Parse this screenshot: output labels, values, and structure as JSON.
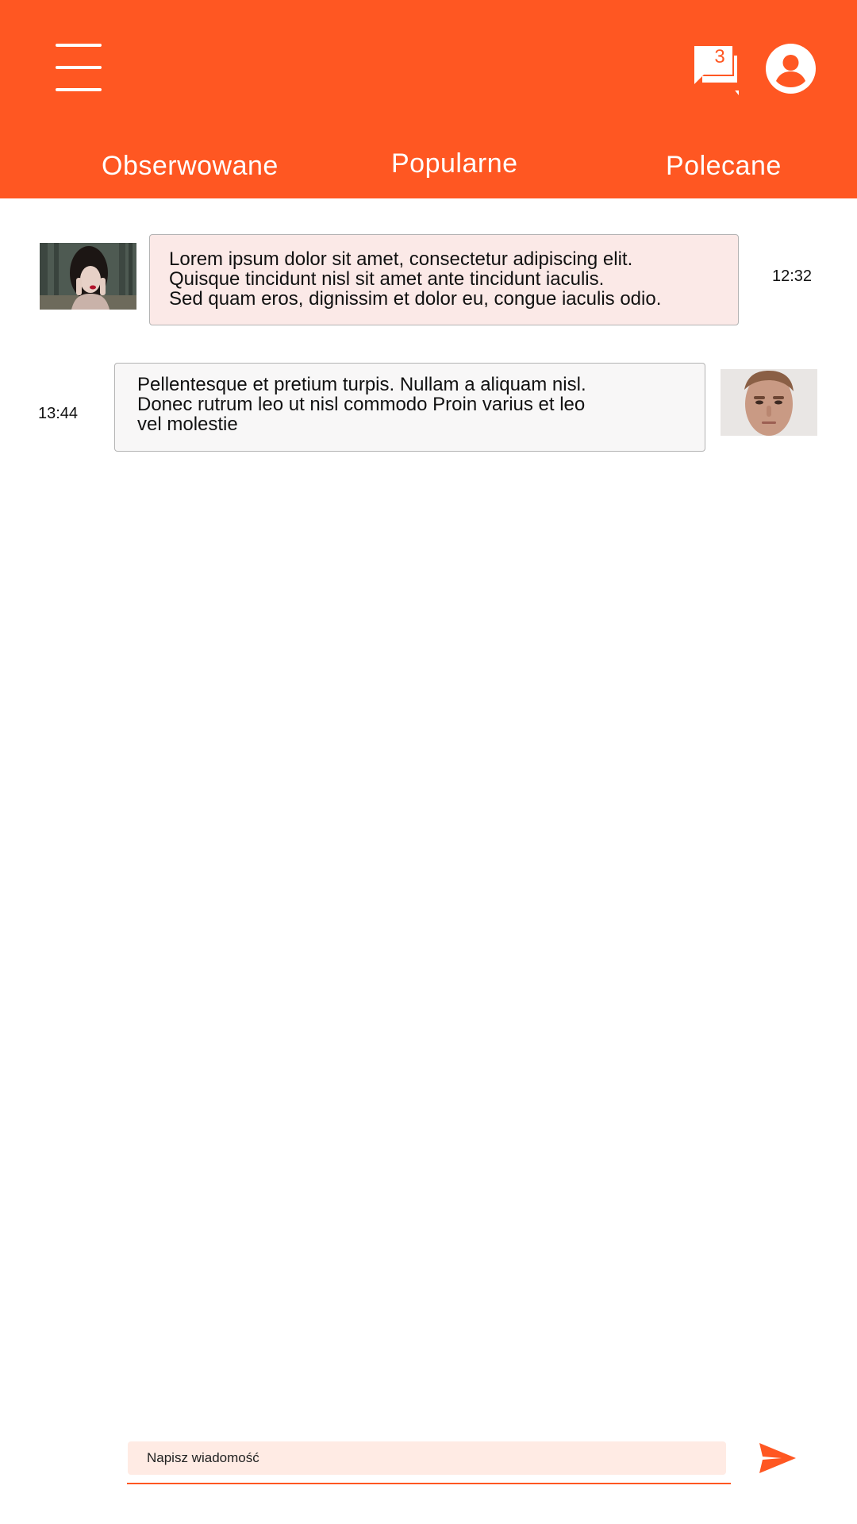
{
  "colors": {
    "primary": "#ff5722",
    "bubble_incoming": "#fbe9e7",
    "bubble_outgoing": "#f8f7f7",
    "composer_bg": "#ffebe4"
  },
  "header": {
    "menu_icon": "hamburger-menu-icon",
    "chat_icon": "chat-bubbles-icon",
    "chat_badge": "3",
    "profile_icon": "account-circle-icon",
    "tabs": [
      {
        "label": "Obserwowane"
      },
      {
        "label": "Popularne"
      },
      {
        "label": "Polecane"
      }
    ]
  },
  "messages": [
    {
      "text": "Lorem ipsum dolor sit amet, consectetur adipiscing elit.\nQuisque tincidunt nisl sit amet ante tincidunt iaculis.\nSed quam eros, dignissim et dolor eu, congue iaculis odio.",
      "time": "12:32"
    },
    {
      "text": "Pellentesque et pretium turpis. Nullam a aliquam nisl.\nDonec rutrum leo ut nisl commodo Proin varius et leo\nvel molestie",
      "time": "13:44"
    }
  ],
  "composer": {
    "placeholder": "Napisz wiadomość",
    "value": "",
    "send_icon": "send-icon"
  }
}
